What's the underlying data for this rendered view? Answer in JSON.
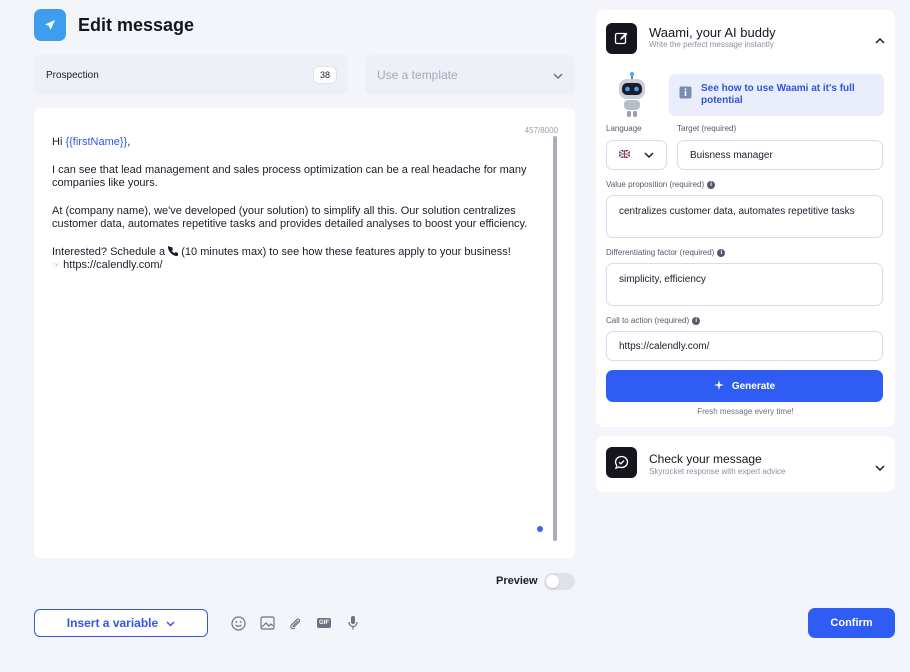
{
  "header": {
    "title": "Edit message"
  },
  "campaign": {
    "name": "Prospection",
    "count": "38"
  },
  "template_select": {
    "placeholder": "Use a template"
  },
  "editor": {
    "char_count": "457/8000",
    "greeting_prefix": "Hi ",
    "greeting_variable": "{{firstName}}",
    "greeting_suffix": ",",
    "paragraph_1": "I can see that lead management and sales process optimization can be a real headache for many companies like yours.",
    "paragraph_2": "At (company name), we've developed (your solution) to simplify all this. Our solution centralizes customer data, automates repetitive tasks and provides detailed analyses to boost your efficiency.",
    "paragraph_3_prefix": "Interested? Schedule a ",
    "paragraph_3_suffix": " (10 minutes max) to see how these features apply to your business!",
    "link_line": "https://calendly.com/"
  },
  "preview": {
    "label": "Preview",
    "enabled": false
  },
  "toolbar": {
    "insert_variable_label": "Insert a variable",
    "tools": [
      "emoji-icon",
      "image-icon",
      "attachment-icon",
      "gif-icon",
      "microphone-icon"
    ],
    "gif_text": "GIF",
    "confirm_label": "Confirm"
  },
  "ai_panel": {
    "title": "Waami, your AI buddy",
    "subtitle": "Write the perfect message instantly",
    "help_link": "See how to use Waami at it's full potential",
    "language_label": "Language",
    "target_label": "Target (required)",
    "target_value": "Buisness manager",
    "value_prop_label": "Value proposition (required)",
    "value_prop_value": "centralizes customer data, automates repetitive tasks",
    "diff_label": "Differentiating factor (required)",
    "diff_value": "simplicity, efficiency",
    "cta_label": "Call to action (required)",
    "cta_value": "https://calendly.com/",
    "generate_label": "Generate",
    "generate_note": "Fresh message every time!"
  },
  "check_panel": {
    "title": "Check your message",
    "subtitle": "Skyrocket response with expert advice"
  },
  "colors": {
    "accent": "#2f5cf2",
    "variable": "#3556e6",
    "header_icon_bg": "#3f9df0",
    "background": "#f3f5fb"
  }
}
